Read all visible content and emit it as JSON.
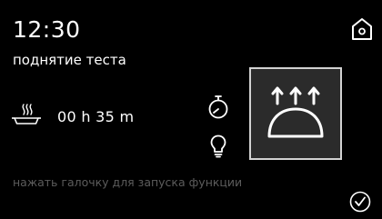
{
  "header": {
    "time": "12:30",
    "function_name": "поднятие теста",
    "home_icon": "home-icon"
  },
  "program": {
    "dish_icon": "dish-with-steam-icon",
    "duration": "00 h 35 m"
  },
  "controls": {
    "timer_icon": "stopwatch-icon",
    "light_icon": "light-bulb-icon"
  },
  "mode": {
    "icon": "dough-proofing-icon"
  },
  "footer": {
    "hint": "нажать галочку для запуска функции",
    "confirm_icon": "checkmark-icon"
  },
  "colors": {
    "background": "#000000",
    "text": "#ffffff",
    "hint_text": "#5c5c5c",
    "tile_fill": "#2b2b2b",
    "tile_border": "#d2d2d2"
  }
}
